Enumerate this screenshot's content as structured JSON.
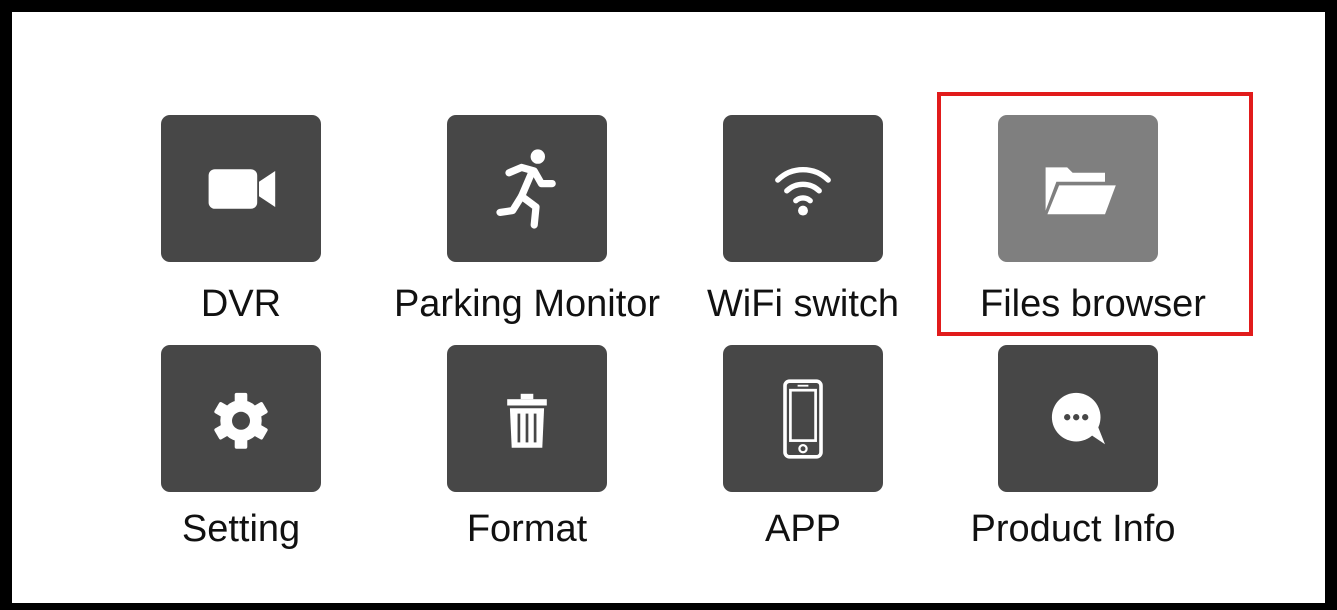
{
  "menu": {
    "items": [
      {
        "id": "dvr",
        "label": "DVR",
        "icon": "video-camera-icon"
      },
      {
        "id": "parking",
        "label": "Parking Monitor",
        "icon": "running-person-icon"
      },
      {
        "id": "wifi",
        "label": "WiFi switch",
        "icon": "wifi-icon"
      },
      {
        "id": "files",
        "label": "Files browser",
        "icon": "open-folder-icon",
        "selected": true
      },
      {
        "id": "setting",
        "label": "Setting",
        "icon": "gear-icon"
      },
      {
        "id": "format",
        "label": "Format",
        "icon": "trash-icon"
      },
      {
        "id": "app",
        "label": "APP",
        "icon": "smartphone-icon"
      },
      {
        "id": "info",
        "label": "Product Info",
        "icon": "chat-bubble-icon"
      }
    ]
  },
  "colors": {
    "tile": "#474747",
    "tile_selected": "#7f7f7f",
    "highlight": "#e11b1b",
    "frame": "#000000"
  }
}
